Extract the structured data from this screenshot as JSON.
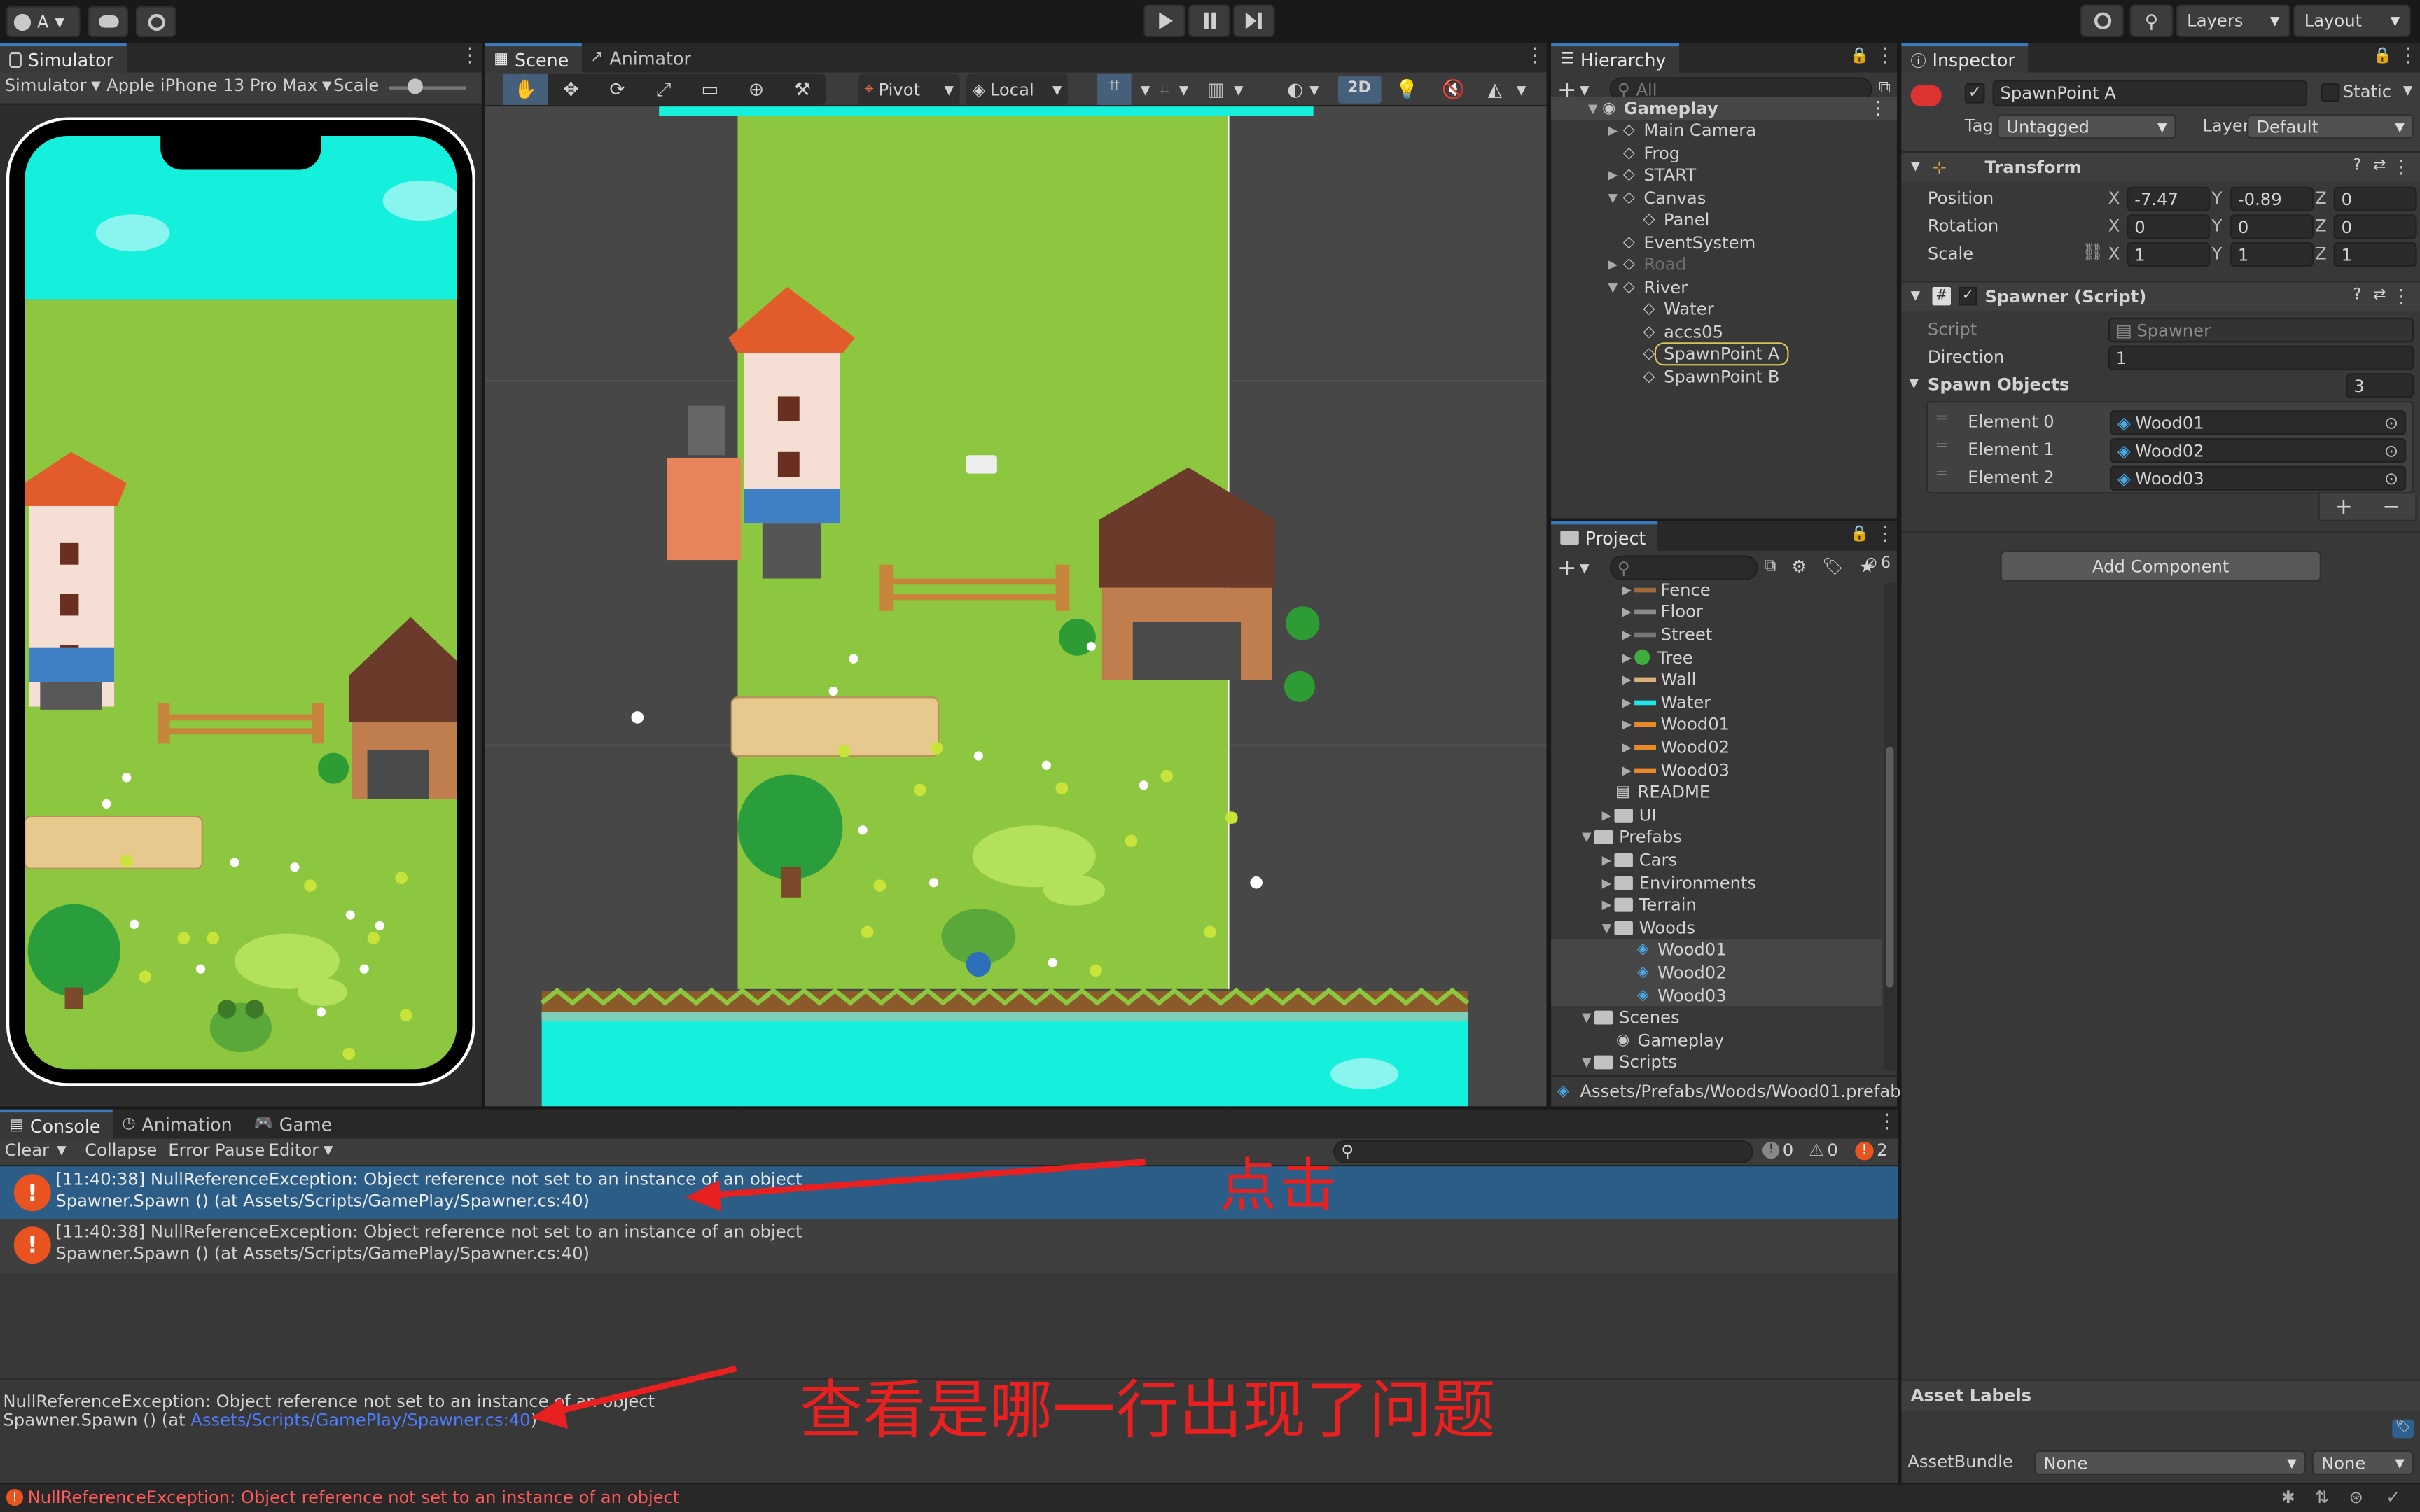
{
  "toolbar": {
    "account": "A",
    "play_icon": "play-icon",
    "pause_icon": "pause-icon",
    "step_icon": "step-icon",
    "layers": "Layers",
    "layout": "Layout"
  },
  "simulator": {
    "tab": "Simulator",
    "mode": "Simulator",
    "device": "Apple iPhone 13 Pro Max",
    "scale_label": "Scale"
  },
  "scene": {
    "tabs": [
      "Scene",
      "Animator"
    ],
    "pivot": "Pivot",
    "local": "Local",
    "mode_2d": "2D"
  },
  "hierarchy": {
    "tab": "Hierarchy",
    "search_placeholder": "All",
    "items": [
      {
        "label": "Gameplay",
        "depth": 0,
        "expanded": true,
        "kind": "scene"
      },
      {
        "label": "Main Camera",
        "depth": 1,
        "expanded": false,
        "kind": "go"
      },
      {
        "label": "Frog",
        "depth": 1,
        "kind": "go"
      },
      {
        "label": "START",
        "depth": 1,
        "expanded": false,
        "kind": "go"
      },
      {
        "label": "Canvas",
        "depth": 1,
        "expanded": true,
        "kind": "go"
      },
      {
        "label": "Panel",
        "depth": 2,
        "kind": "go"
      },
      {
        "label": "EventSystem",
        "depth": 1,
        "kind": "go"
      },
      {
        "label": "Road",
        "depth": 1,
        "expanded": false,
        "kind": "go",
        "disabled": true
      },
      {
        "label": "River",
        "depth": 1,
        "expanded": true,
        "kind": "go"
      },
      {
        "label": "Water",
        "depth": 2,
        "kind": "go"
      },
      {
        "label": "accs05",
        "depth": 2,
        "kind": "go"
      },
      {
        "label": "SpawnPoint A",
        "depth": 2,
        "kind": "go",
        "selected": true
      },
      {
        "label": "SpawnPoint B",
        "depth": 2,
        "kind": "go"
      }
    ]
  },
  "project": {
    "tab": "Project",
    "hidden_count": "6",
    "path": "Assets/Prefabs/Woods/Wood01.prefab",
    "items": [
      {
        "label": "Fence",
        "depth": 2,
        "arrow": "right",
        "icon": "tile",
        "color": "#a06a3a"
      },
      {
        "label": "Floor",
        "depth": 2,
        "arrow": "right",
        "icon": "tile",
        "color": "#8a8a8a"
      },
      {
        "label": "Street",
        "depth": 2,
        "arrow": "right",
        "icon": "tile",
        "color": "#777777"
      },
      {
        "label": "Tree",
        "depth": 2,
        "arrow": "right",
        "icon": "tree",
        "color": "#3fae3f"
      },
      {
        "label": "Wall",
        "depth": 2,
        "arrow": "right",
        "icon": "tile",
        "color": "#d7b27a"
      },
      {
        "label": "Water",
        "depth": 2,
        "arrow": "right",
        "icon": "tile",
        "color": "#1de8e8"
      },
      {
        "label": "Wood01",
        "depth": 2,
        "arrow": "right",
        "icon": "tile",
        "color": "#e88a2a"
      },
      {
        "label": "Wood02",
        "depth": 2,
        "arrow": "right",
        "icon": "tile",
        "color": "#e88a2a"
      },
      {
        "label": "Wood03",
        "depth": 2,
        "arrow": "right",
        "icon": "tile",
        "color": "#e88a2a"
      },
      {
        "label": "README",
        "depth": 1,
        "arrow": "",
        "icon": "doc",
        "color": "#dddddd"
      },
      {
        "label": "UI",
        "depth": 1,
        "arrow": "right",
        "icon": "folder",
        "color": "#c2c2c2"
      },
      {
        "label": "Prefabs",
        "depth": 0,
        "arrow": "down",
        "icon": "folder",
        "color": "#c2c2c2"
      },
      {
        "label": "Cars",
        "depth": 1,
        "arrow": "right",
        "icon": "folder",
        "color": "#c2c2c2"
      },
      {
        "label": "Environments",
        "depth": 1,
        "arrow": "right",
        "icon": "folder",
        "color": "#c2c2c2"
      },
      {
        "label": "Terrain",
        "depth": 1,
        "arrow": "right",
        "icon": "folder",
        "color": "#c2c2c2"
      },
      {
        "label": "Woods",
        "depth": 1,
        "arrow": "down",
        "icon": "folder",
        "color": "#c2c2c2"
      },
      {
        "label": "Wood01",
        "depth": 2,
        "arrow": "",
        "icon": "prefab",
        "color": "#4aa8e8",
        "highlight": true
      },
      {
        "label": "Wood02",
        "depth": 2,
        "arrow": "",
        "icon": "prefab",
        "color": "#4aa8e8",
        "highlight": true
      },
      {
        "label": "Wood03",
        "depth": 2,
        "arrow": "",
        "icon": "prefab",
        "color": "#4aa8e8",
        "highlight": true
      },
      {
        "label": "Scenes",
        "depth": 0,
        "arrow": "down",
        "icon": "folder",
        "color": "#c2c2c2"
      },
      {
        "label": "Gameplay",
        "depth": 1,
        "arrow": "",
        "icon": "scene",
        "color": "#dddddd"
      },
      {
        "label": "Scripts",
        "depth": 0,
        "arrow": "down",
        "icon": "folder",
        "color": "#c2c2c2"
      }
    ]
  },
  "inspector": {
    "tab": "Inspector",
    "name": "SpawnPoint A",
    "static": "Static",
    "tag_label": "Tag",
    "tag": "Untagged",
    "layer_label": "Layer",
    "layer": "Default",
    "transform": {
      "title": "Transform",
      "position_label": "Position",
      "rotation_label": "Rotation",
      "scale_label": "Scale",
      "position": {
        "x": "-7.47",
        "y": "-0.89",
        "z": "0"
      },
      "rotation": {
        "x": "0",
        "y": "0",
        "z": "0"
      },
      "scale": {
        "x": "1",
        "y": "1",
        "z": "1"
      }
    },
    "spawner": {
      "title": "Spawner (Script)",
      "script_label": "Script",
      "script": "Spawner",
      "direction_label": "Direction",
      "direction": "1",
      "spawn_objects_label": "Spawn Objects",
      "count": "3",
      "elements": [
        {
          "label": "Element 0",
          "value": "Wood01"
        },
        {
          "label": "Element 1",
          "value": "Wood02"
        },
        {
          "label": "Element 2",
          "value": "Wood03"
        }
      ]
    },
    "add_component": "Add Component",
    "asset_labels": "Asset Labels",
    "asset_bundle_label": "AssetBundle",
    "asset_bundle": "None",
    "asset_variant": "None"
  },
  "console": {
    "tabs": [
      "Console",
      "Animation",
      "Game"
    ],
    "clear": "Clear",
    "collapse": "Collapse",
    "error_pause": "Error Pause",
    "editor": "Editor",
    "log_count": "0",
    "warn_count": "0",
    "error_count": "2",
    "entries": [
      {
        "line1": "[11:40:38] NullReferenceException: Object reference not set to an instance of an object",
        "line2": "Spawner.Spawn () (at Assets/Scripts/GamePlay/Spawner.cs:40)"
      },
      {
        "line1": "[11:40:38] NullReferenceException: Object reference not set to an instance of an object",
        "line2": "Spawner.Spawn () (at Assets/Scripts/GamePlay/Spawner.cs:40)"
      }
    ],
    "detail_line1": "NullReferenceException: Object reference not set to an instance of an object",
    "detail_prefix": "Spawner.Spawn () (at ",
    "detail_link": "Assets/Scripts/GamePlay/Spawner.cs:40",
    "detail_suffix": ")"
  },
  "status": {
    "message": "NullReferenceException: Object reference not set to an instance of an object"
  },
  "annotations": {
    "click": "点击",
    "check": "查看是哪一行出现了问题"
  },
  "colors": {
    "accent": "#3a79bb",
    "selection": "#2c5d87",
    "error": "#e8531f",
    "annotation": "#e8201f",
    "grass": "#8dc63f",
    "water": "#14f0dc"
  }
}
